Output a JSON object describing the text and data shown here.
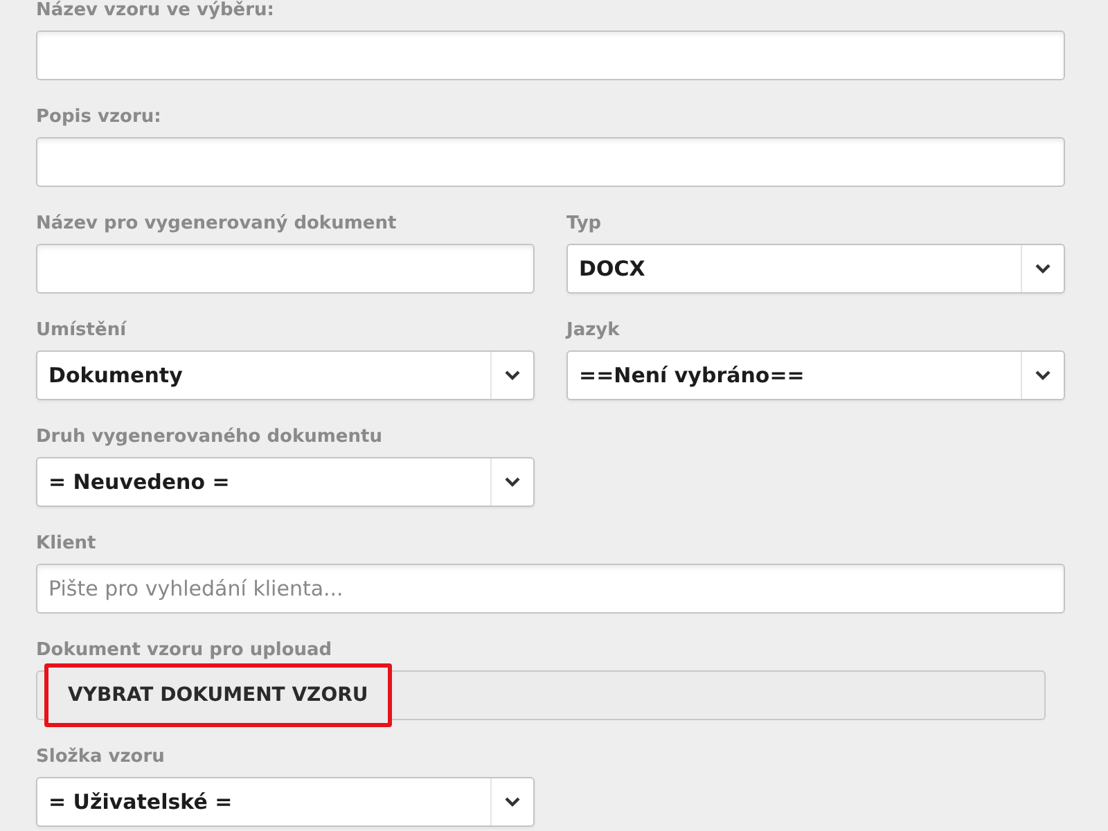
{
  "rows": [
    [
      {
        "label": "Název vzoru ve výběru:",
        "kind": "text"
      }
    ],
    [
      {
        "label": "Popis vzoru:",
        "kind": "text"
      }
    ],
    [
      {
        "label": "Název pro vygenerovaný dokument",
        "kind": "text"
      },
      {
        "label": "Typ",
        "kind": "select",
        "value": "DOCX"
      }
    ],
    [
      {
        "label": "Umístění",
        "kind": "select",
        "value": "Dokumenty"
      },
      {
        "label": "Jazyk",
        "kind": "select",
        "value": "==Není vybráno=="
      }
    ],
    [
      {
        "label": "Druh vygenerovaného dokumentu",
        "kind": "select",
        "value": "= Neuvedeno ="
      }
    ],
    [
      {
        "label": "Klient",
        "kind": "text",
        "placeholder": "Pište pro vyhledání klienta..."
      }
    ],
    [
      {
        "label": "Dokument vzoru pro uplouad",
        "kind": "upload",
        "button": "VYBRAT DOKUMENT VZORU",
        "highlighted": true
      }
    ],
    [
      {
        "label": "Složka vzoru",
        "kind": "select",
        "value": "= Uživatelské ="
      }
    ]
  ]
}
